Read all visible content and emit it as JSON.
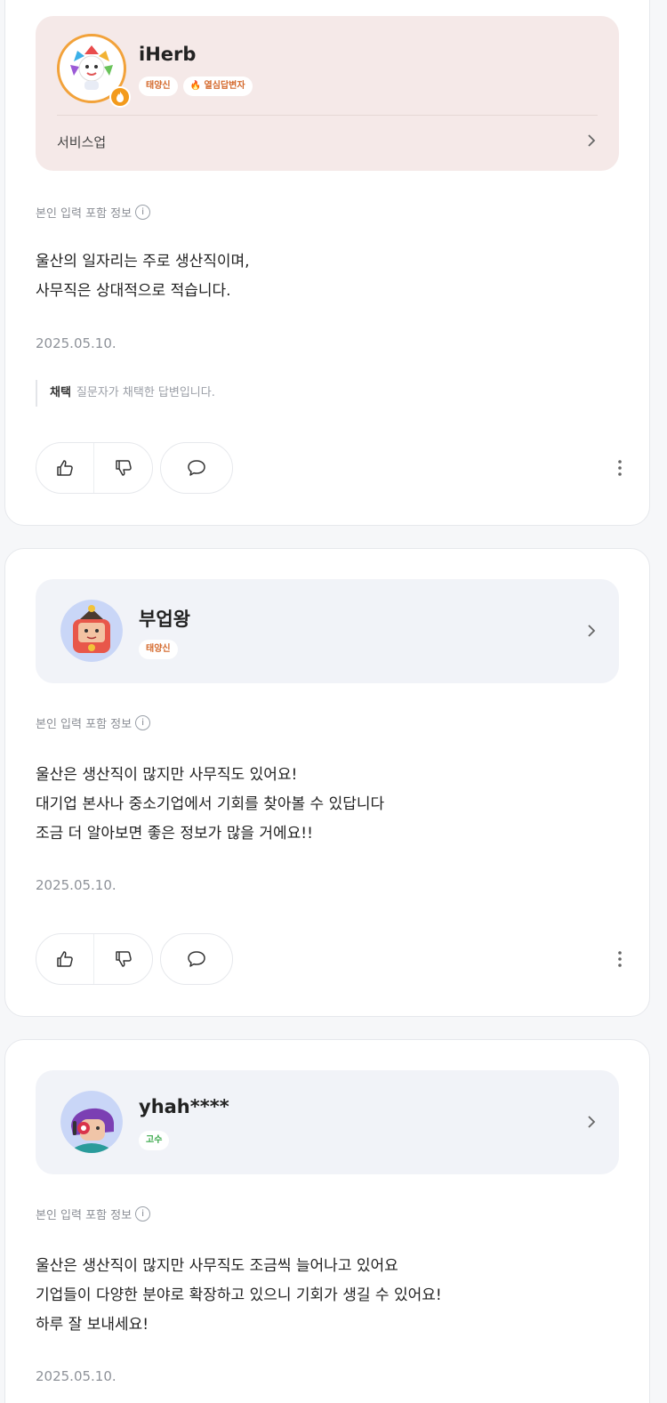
{
  "answers": [
    {
      "username": "iHerb",
      "tags": [
        "태양신",
        "🔥 열심답변자"
      ],
      "category": "서비스업",
      "info_label": "본인 입력 포함 정보",
      "lines": [
        "울산의 일자리는 주로 생산직이며,",
        "사무직은 상대적으로 적습니다."
      ],
      "date": "2025.05.10.",
      "adopt_label": "채택",
      "adopt_text": "질문자가 채택한 답변입니다."
    },
    {
      "username": "부업왕",
      "tags": [
        "태양신"
      ],
      "info_label": "본인 입력 포함 정보",
      "lines": [
        "울산은 생산직이 많지만 사무직도 있어요!",
        "대기업 본사나 중소기업에서 기회를 찾아볼 수 있답니다",
        "조금 더 알아보면 좋은 정보가 많을 거에요!!"
      ],
      "date": "2025.05.10."
    },
    {
      "username": "yhah****",
      "tags": [
        "고수"
      ],
      "info_label": "본인 입력 포함 정보",
      "lines": [
        "울산은 생산직이 많지만 사무직도 조금씩 늘어나고 있어요",
        "기업들이 다양한 분야로 확장하고 있으니 기회가 생길 수 있어요!",
        "하루 잘 보내세요!"
      ],
      "date": "2025.05.10."
    }
  ],
  "icons": {
    "like": "thumbs-up-icon",
    "dislike": "thumbs-down-icon",
    "comment": "speech-bubble-icon",
    "more": "more-vertical-icon",
    "chevron": "chevron-right-icon",
    "info": "info-icon"
  },
  "colors": {
    "profile_pink": "#f5e9e8",
    "profile_gray": "#f1f3f8",
    "tag_orange": "#d4692c",
    "tag_green": "#3aa84a"
  }
}
